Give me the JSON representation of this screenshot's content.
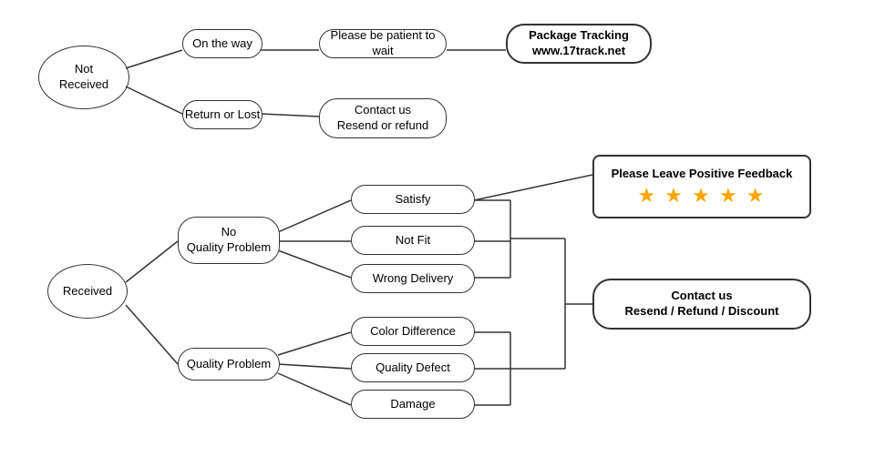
{
  "nodes": {
    "not_received": {
      "label": "Not\nReceived"
    },
    "on_the_way": {
      "label": "On the way"
    },
    "return_or_lost": {
      "label": "Return or Lost"
    },
    "patient": {
      "label": "Please be patient to wait"
    },
    "package_tracking": {
      "label": "Package Tracking\nwww.17track.net"
    },
    "contact_resend": {
      "label": "Contact us\nResend or refund"
    },
    "received": {
      "label": "Received"
    },
    "no_quality": {
      "label": "No\nQuality Problem"
    },
    "quality_problem": {
      "label": "Quality Problem"
    },
    "satisfy": {
      "label": "Satisfy"
    },
    "not_fit": {
      "label": "Not Fit"
    },
    "wrong_delivery": {
      "label": "Wrong Delivery"
    },
    "color_diff": {
      "label": "Color Difference"
    },
    "quality_defect": {
      "label": "Quality Defect"
    },
    "damage": {
      "label": "Damage"
    },
    "feedback_title": {
      "label": "Please Leave Positive Feedback"
    },
    "feedback_stars": {
      "label": "★ ★ ★ ★ ★"
    },
    "contact_resend2": {
      "label": "Contact us\nResend / Refund / Discount"
    }
  }
}
